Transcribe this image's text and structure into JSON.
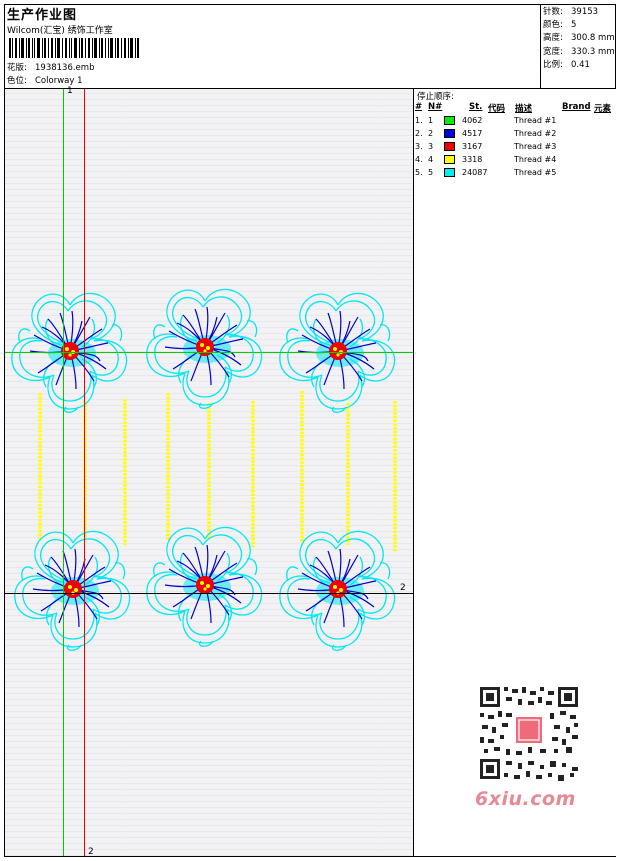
{
  "header": {
    "title": "生产作业图",
    "subtitle": "Wilcom(汇宝) 绣饰工作室",
    "design_file_label": "花版:",
    "design_file": "1938136.emb",
    "colorway_label": "色位:",
    "colorway": "Colorway 1"
  },
  "stats": {
    "stitches_label": "针数:",
    "stitches": "39153",
    "colors_label": "颜色:",
    "colors": "5",
    "height_label": "高度:",
    "height": "300.8 mm",
    "width_label": "宽度:",
    "width": "330.3 mm",
    "scale_label": "比例:",
    "scale": "0.41"
  },
  "thread_panel": {
    "heading": "停止顺序:",
    "columns": {
      "num": "#",
      "n": "N#",
      "st": "St.",
      "code": "代码",
      "desc": "描述",
      "brand": "Brand",
      "element": "元素"
    },
    "rows": [
      {
        "num": "1.",
        "n": "1",
        "color": "#00ee00",
        "code": "4062",
        "desc": "Thread #1"
      },
      {
        "num": "2.",
        "n": "2",
        "color": "#0000dd",
        "code": "4517",
        "desc": "Thread #2"
      },
      {
        "num": "3.",
        "n": "3",
        "color": "#ee0000",
        "code": "3167",
        "desc": "Thread #3"
      },
      {
        "num": "4.",
        "n": "4",
        "color": "#ffff00",
        "code": "3318",
        "desc": "Thread #4"
      },
      {
        "num": "5.",
        "n": "5",
        "color": "#00eeee",
        "code": "24087",
        "desc": "Thread #5"
      }
    ]
  },
  "guides": {
    "label_1_top": "1",
    "label_2_right": "2",
    "label_2_bottom": "2"
  },
  "watermark": "6xiu.com",
  "colors": {
    "green_guide": "#00cc00",
    "red_guide": "#ee0000",
    "cyan": "#00e8f0",
    "blue": "#0000cc",
    "red": "#ee0000",
    "yellow": "#ffff00"
  }
}
